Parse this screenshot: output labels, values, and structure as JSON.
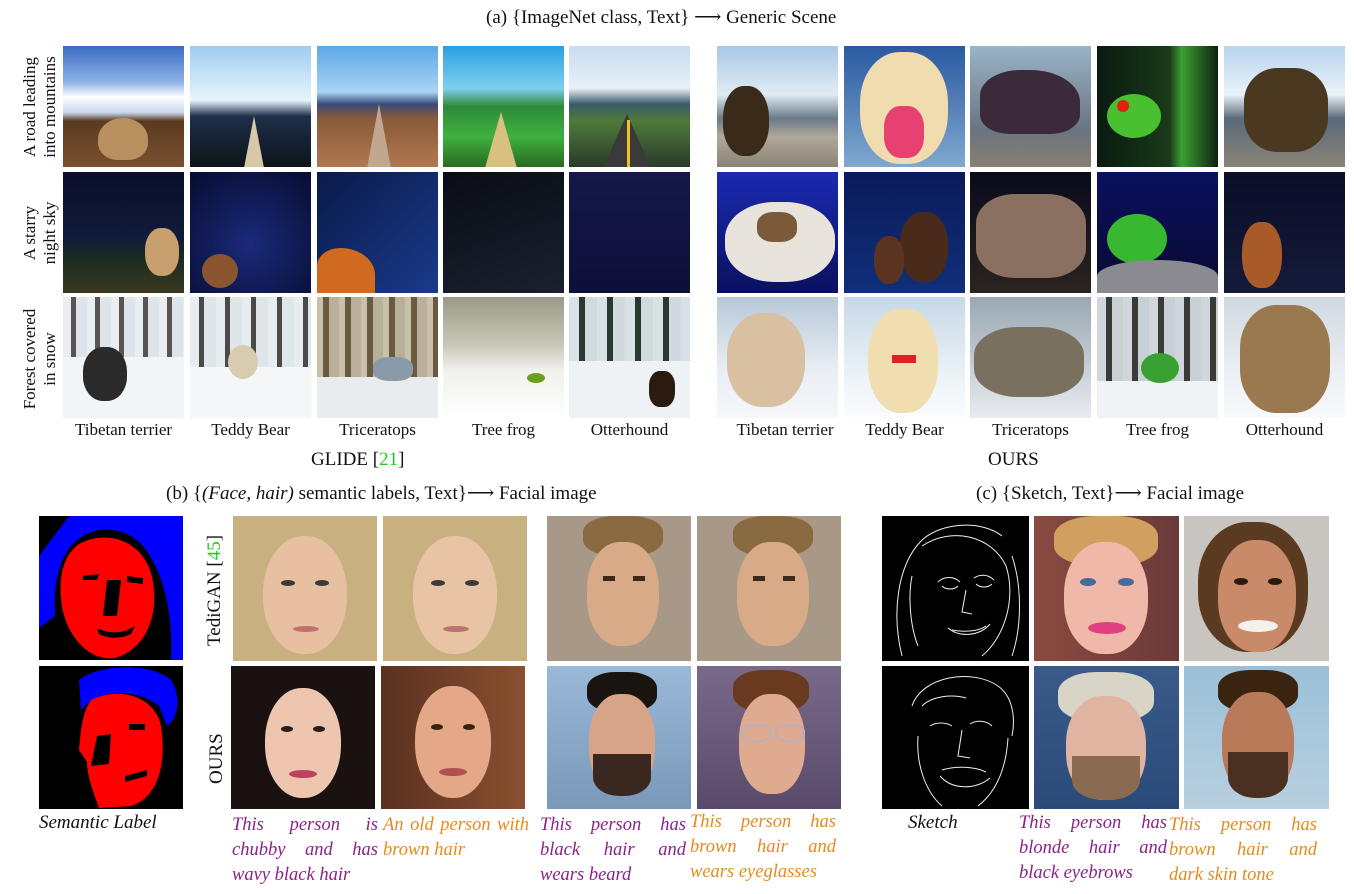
{
  "section_a": {
    "title_prefix": "(a) {ImageNet class, Text} ",
    "arrow": "⟶",
    "title_suffix": " Generic Scene",
    "row_labels": [
      {
        "line1": "A road leading",
        "line2": "into mountains"
      },
      {
        "line1": "A starry",
        "line2": "night sky"
      },
      {
        "line1": "Forest covered",
        "line2": "in snow"
      }
    ],
    "classes": [
      "Tibetan terrier",
      "Teddy Bear",
      "Triceratops",
      "Tree frog",
      "Otterhound"
    ],
    "left_method_name": "GLIDE [",
    "left_method_ref": "21",
    "left_method_close": "]",
    "right_method": "OURS"
  },
  "section_b": {
    "title_prefix": "(b) {",
    "title_italic": "(Face, hair)",
    "title_suffix": " semantic labels, Text}",
    "arrow": "⟶",
    "title_end": " Facial image",
    "tedigan_label": "TediGAN [",
    "tedigan_ref": "45",
    "tedigan_close": "]",
    "ours_label": "OURS",
    "semantic_caption": "Semantic Label",
    "prompts": [
      "This person is chubby and has wavy black hair",
      "An old person with brown hair",
      "This person has black hair and wears beard",
      "This person has brown hair and wears eyeglasses"
    ]
  },
  "section_c": {
    "title_prefix": "(c) {Sketch, Text}",
    "arrow": "⟶",
    "title_suffix": " Facial image",
    "sketch_caption": "Sketch",
    "prompts": [
      "This person has blonde hair and black eyebrows",
      "This person has brown hair and dark skin tone"
    ]
  },
  "colors": {
    "ref_green": "#22cc22",
    "prompt_purple": "#8a228a",
    "prompt_orange": "#e88a1a",
    "label_face": "#ff0000",
    "label_hair": "#0000ff"
  }
}
